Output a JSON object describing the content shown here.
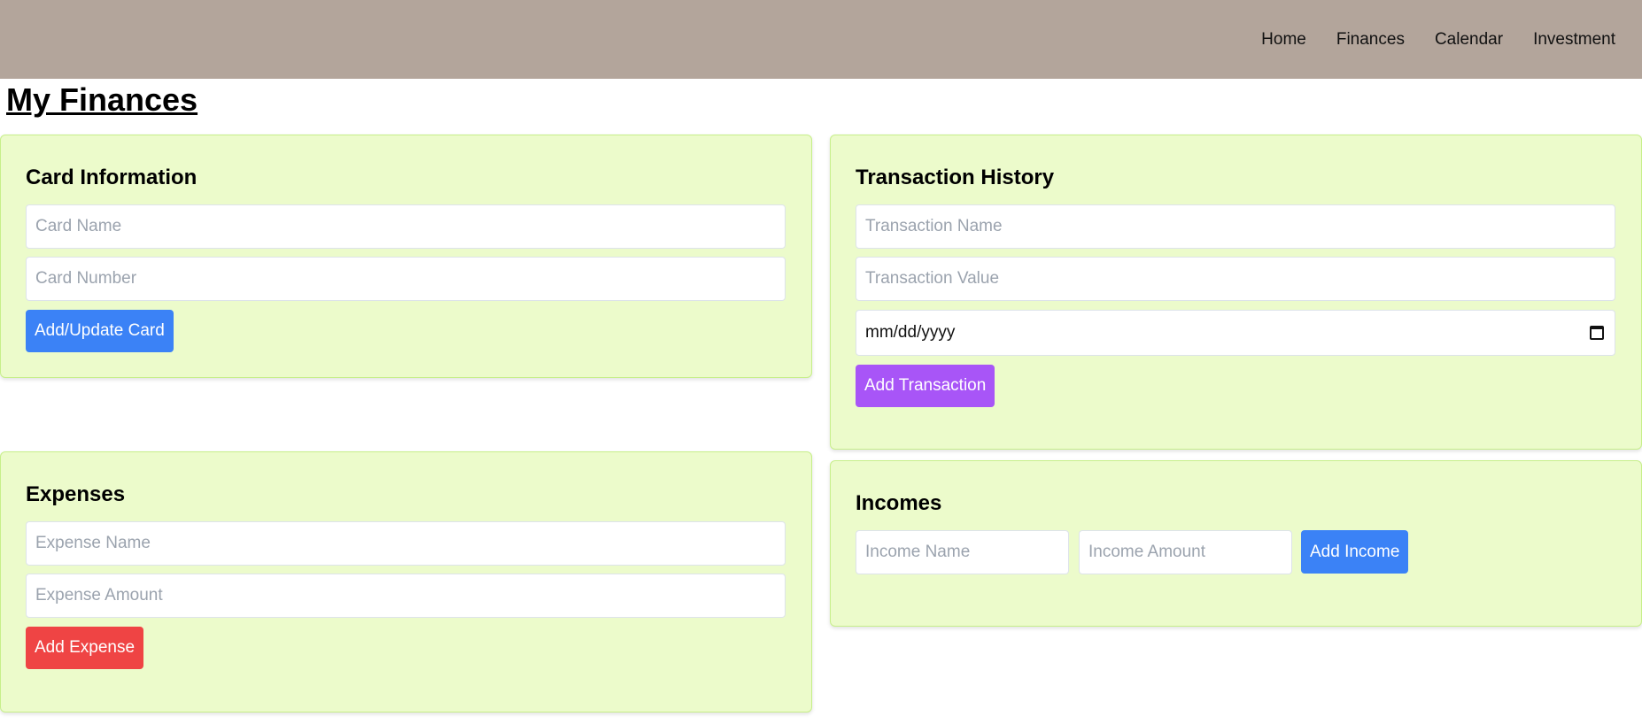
{
  "nav": {
    "items": [
      "Home",
      "Finances",
      "Calendar",
      "Investment"
    ]
  },
  "page": {
    "title": "My Finances"
  },
  "card_info": {
    "title": "Card Information",
    "name_placeholder": "Card Name",
    "number_placeholder": "Card Number",
    "button": "Add/Update Card"
  },
  "transactions": {
    "title": "Transaction History",
    "name_placeholder": "Transaction Name",
    "value_placeholder": "Transaction Value",
    "date_placeholder": "mm/dd/yyyy",
    "button": "Add Transaction"
  },
  "expenses": {
    "title": "Expenses",
    "name_placeholder": "Expense Name",
    "amount_placeholder": "Expense Amount",
    "button": "Add Expense"
  },
  "incomes": {
    "title": "Incomes",
    "name_placeholder": "Income Name",
    "amount_placeholder": "Income Amount",
    "button": "Add Income"
  },
  "colors": {
    "navbar": "#b3a59b",
    "card_bg": "#ecfbcb",
    "blue_button": "#3b82f6",
    "purple_button": "#a855f7",
    "red_button": "#ef4444"
  },
  "icons": {
    "date_picker": "calendar-icon"
  }
}
